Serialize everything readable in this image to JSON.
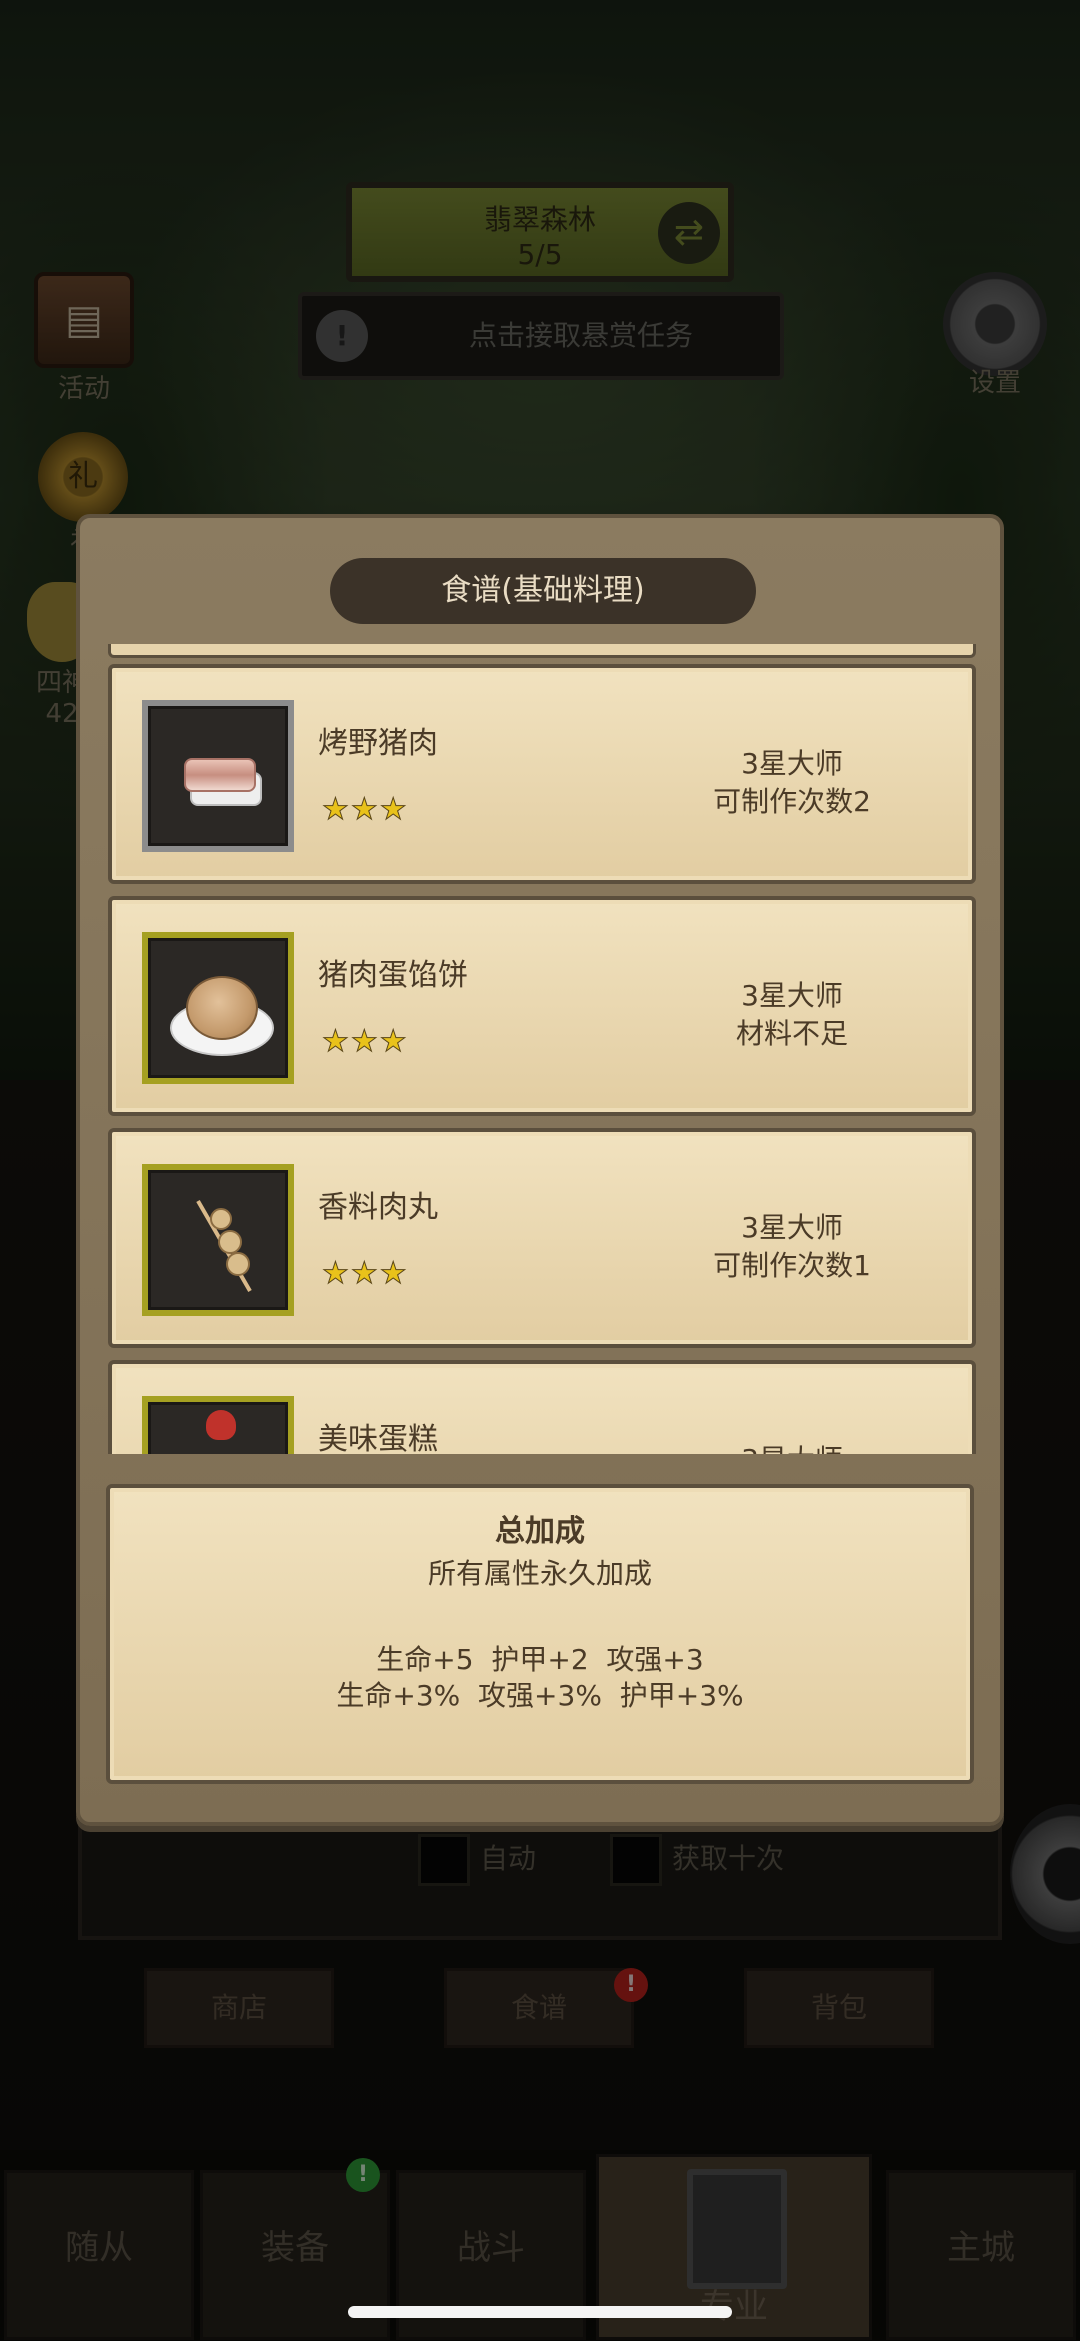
{
  "hud": {
    "zone_name": "翡翠森林",
    "zone_progress": "5/5",
    "bounty_text": "点击接取悬赏任务",
    "activity_label": "活动",
    "settings_label": "设置",
    "gift_label_partial": "礼",
    "side_label_partial": "四神",
    "side_value_partial": "42"
  },
  "modal": {
    "title": "食谱(基础料理)",
    "recipes": [
      {
        "name": "烤野猪肉",
        "stars": "★★★",
        "rank": "3星大师",
        "status": "可制作次数2",
        "frame": "silver"
      },
      {
        "name": "猪肉蛋馅饼",
        "stars": "★★★",
        "rank": "3星大师",
        "status": "材料不足",
        "frame": "gold"
      },
      {
        "name": "香料肉丸",
        "stars": "★★★",
        "rank": "3星大师",
        "status": "可制作次数1",
        "frame": "gold"
      },
      {
        "name": "美味蛋糕",
        "stars": "★★★",
        "rank": "3星大师",
        "status": "",
        "frame": "gold"
      }
    ],
    "bonus": {
      "title": "总加成",
      "subtitle": "所有属性永久加成",
      "line1": "生命+5  护甲+2  攻强+3",
      "line2": "生命+3%  攻强+3%  护甲+3%"
    }
  },
  "background_ui": {
    "auto_label": "自动",
    "ten_label": "获取十次",
    "shop_label": "商店",
    "recipe_label": "食谱",
    "bag_label": "背包"
  },
  "bottom_nav": {
    "tabs": [
      "随从",
      "装备",
      "战斗",
      "专业",
      "主城"
    ],
    "active": "专业"
  },
  "colors": {
    "parchment": "#f1e2bf",
    "modal_frame": "#8b7b60",
    "star": "#e9c21a",
    "badge_red": "#b8211c",
    "badge_green": "#2f9a38"
  }
}
